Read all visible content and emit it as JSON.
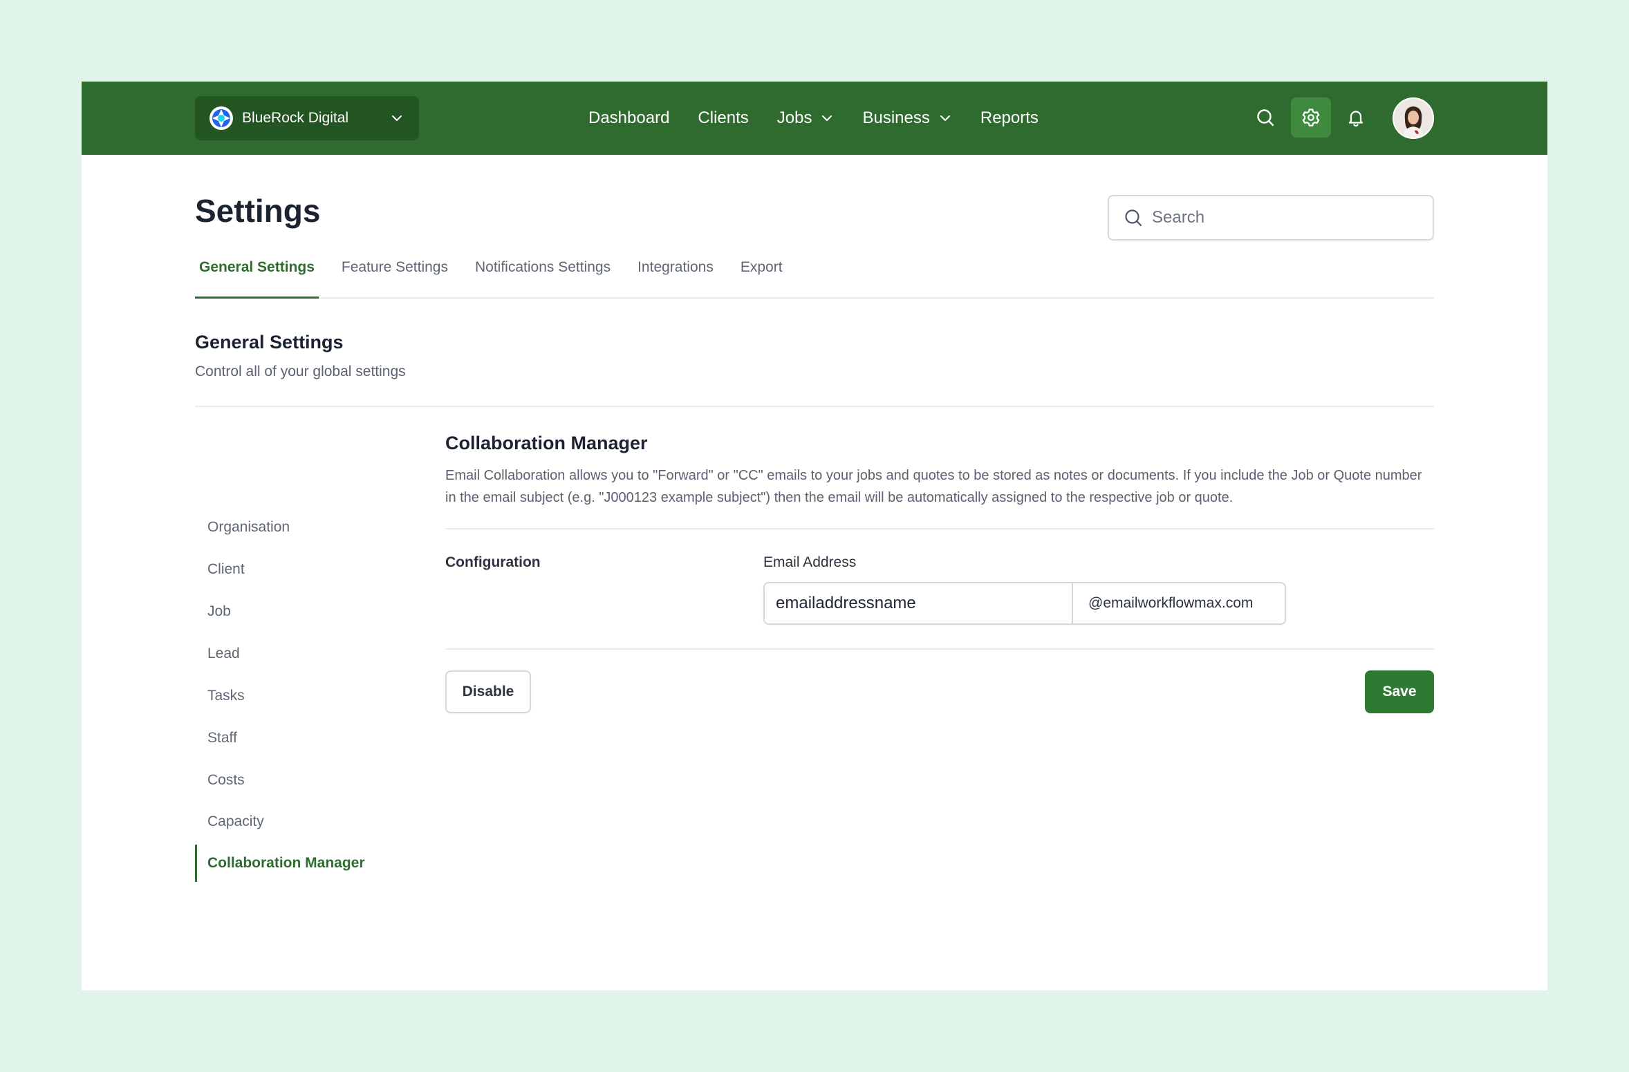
{
  "org": {
    "name": "BlueRock Digital"
  },
  "nav": {
    "links": [
      {
        "label": "Dashboard"
      },
      {
        "label": "Clients"
      },
      {
        "label": "Jobs"
      },
      {
        "label": "Business"
      },
      {
        "label": "Reports"
      }
    ],
    "icons": [
      "search-icon",
      "gear-icon",
      "bell-icon"
    ]
  },
  "page": {
    "title": "Settings",
    "search_placeholder": "Search"
  },
  "tabs": [
    {
      "label": "General Settings",
      "active": true
    },
    {
      "label": "Feature Settings"
    },
    {
      "label": "Notifications Settings"
    },
    {
      "label": "Integrations"
    },
    {
      "label": "Export"
    }
  ],
  "section": {
    "title": "General Settings",
    "subtitle": "Control all of your global settings"
  },
  "sidebar": {
    "items": [
      {
        "label": "Organisation"
      },
      {
        "label": "Client"
      },
      {
        "label": "Job"
      },
      {
        "label": "Lead"
      },
      {
        "label": "Tasks"
      },
      {
        "label": "Staff"
      },
      {
        "label": "Costs"
      },
      {
        "label": "Capacity"
      },
      {
        "label": "Collaboration Manager",
        "active": true
      }
    ]
  },
  "content": {
    "title": "Collaboration Manager",
    "description": "Email Collaboration allows you to \"Forward\" or \"CC\" emails to your jobs and quotes to be stored as notes or documents. If you include the Job or Quote number in the email subject (e.g. \"J000123 example subject\") then the email will be automatically assigned to the respective job or quote.",
    "config_label": "Configuration",
    "email_label": "Email Address",
    "email_value": "emailaddressname",
    "email_suffix": "@emailworkflowmax.com",
    "disable_label": "Disable",
    "save_label": "Save"
  },
  "colors": {
    "brand": "#2f6b2f",
    "brand_dark": "#235523",
    "save": "#2f7a32",
    "background": "#e1f4ea"
  }
}
